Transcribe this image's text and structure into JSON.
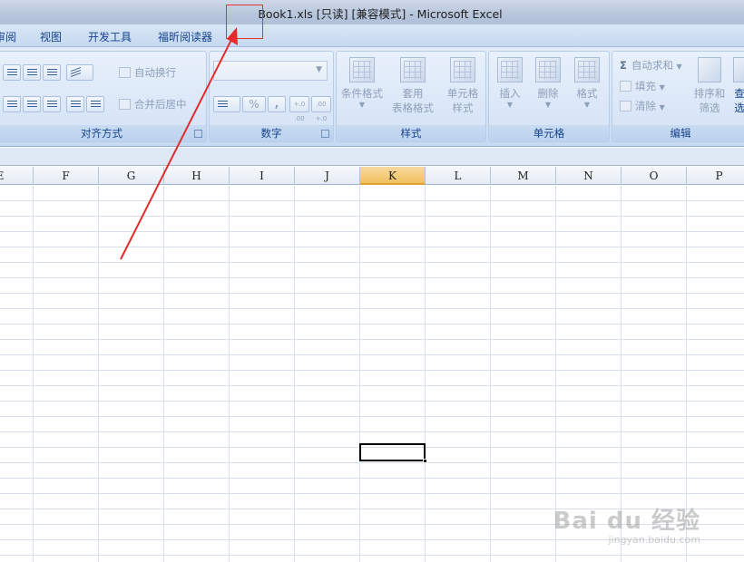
{
  "window": {
    "title": "Book1.xls  [只读]  [兼容模式]  -  Microsoft Excel"
  },
  "tabs": [
    "审阅",
    "视图",
    "开发工具",
    "福昕阅读器"
  ],
  "ribbon": {
    "alignment": {
      "label": "对齐方式",
      "wrap_text": "自动换行",
      "merge_center": "合并后居中"
    },
    "number": {
      "label": "数字",
      "percent": "%",
      "comma": ",",
      "inc_decimal": "+.0 .00",
      "dec_decimal": ".00 +.0"
    },
    "styles": {
      "label": "样式",
      "cond_format": "条件格式",
      "table_format_1": "套用",
      "table_format_2": "表格格式",
      "cell_style_1": "单元格",
      "cell_style_2": "样式"
    },
    "cells": {
      "label": "单元格",
      "insert": "插入",
      "delete": "删除",
      "format": "格式"
    },
    "editing": {
      "label": "编辑",
      "autosum": "自动求和",
      "sigma": "Σ",
      "fill": "填充",
      "clear": "清除",
      "sort_filter_1": "排序和",
      "sort_filter_2": "筛选",
      "find_1": "查",
      "find_2": "选"
    }
  },
  "columns": [
    "E",
    "F",
    "G",
    "H",
    "I",
    "J",
    "K",
    "L",
    "M",
    "N",
    "O",
    "P"
  ],
  "selected_column": "K",
  "watermark": {
    "brand": "Bai du 经验",
    "url": "jingyan.baidu.com"
  }
}
